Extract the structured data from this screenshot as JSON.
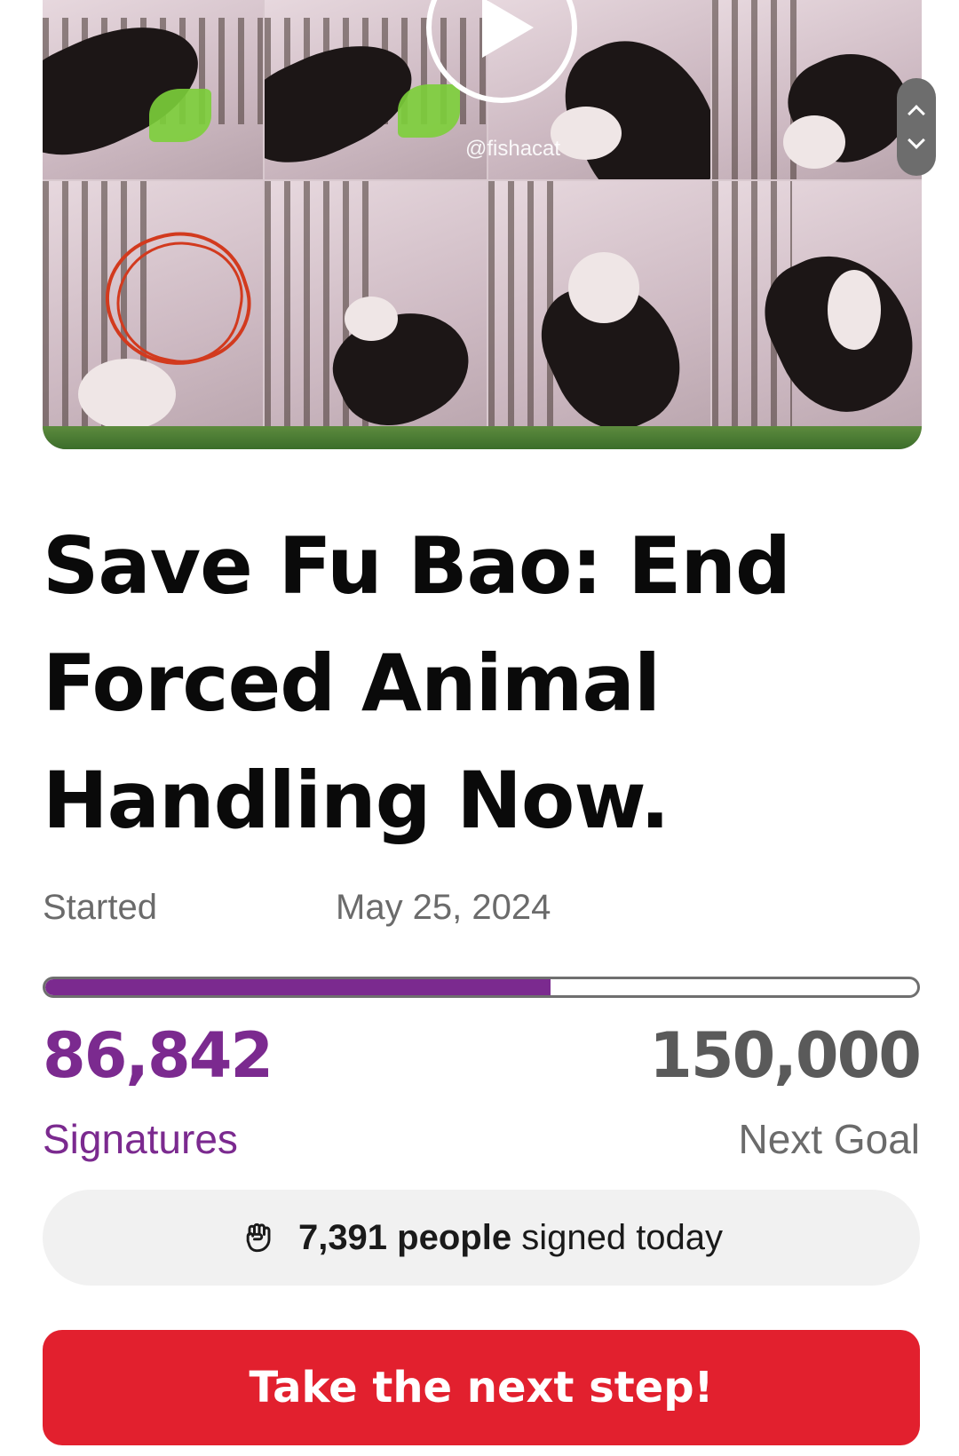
{
  "media": {
    "watermark": "@fishacat",
    "play_icon": "play-icon",
    "scroll_icons": [
      "chevron-up-icon",
      "chevron-down-icon"
    ]
  },
  "petition": {
    "title": "Save Fu Bao: End Forced Animal Handling Now.",
    "started_label": "Started",
    "started_date": "May 25, 2024"
  },
  "progress": {
    "signatures": "86,842",
    "signatures_label": "Signatures",
    "goal": "150,000",
    "goal_label": "Next Goal",
    "fraction": 0.579
  },
  "today": {
    "icon": "raised-fist-icon",
    "count_text": "7,391 people",
    "suffix_text": "signed today"
  },
  "cta": {
    "label": "Take the next step!"
  },
  "colors": {
    "accent_purple": "#7b2a8f",
    "cta_red": "#e2202e",
    "muted_gray": "#6b6b6b"
  }
}
